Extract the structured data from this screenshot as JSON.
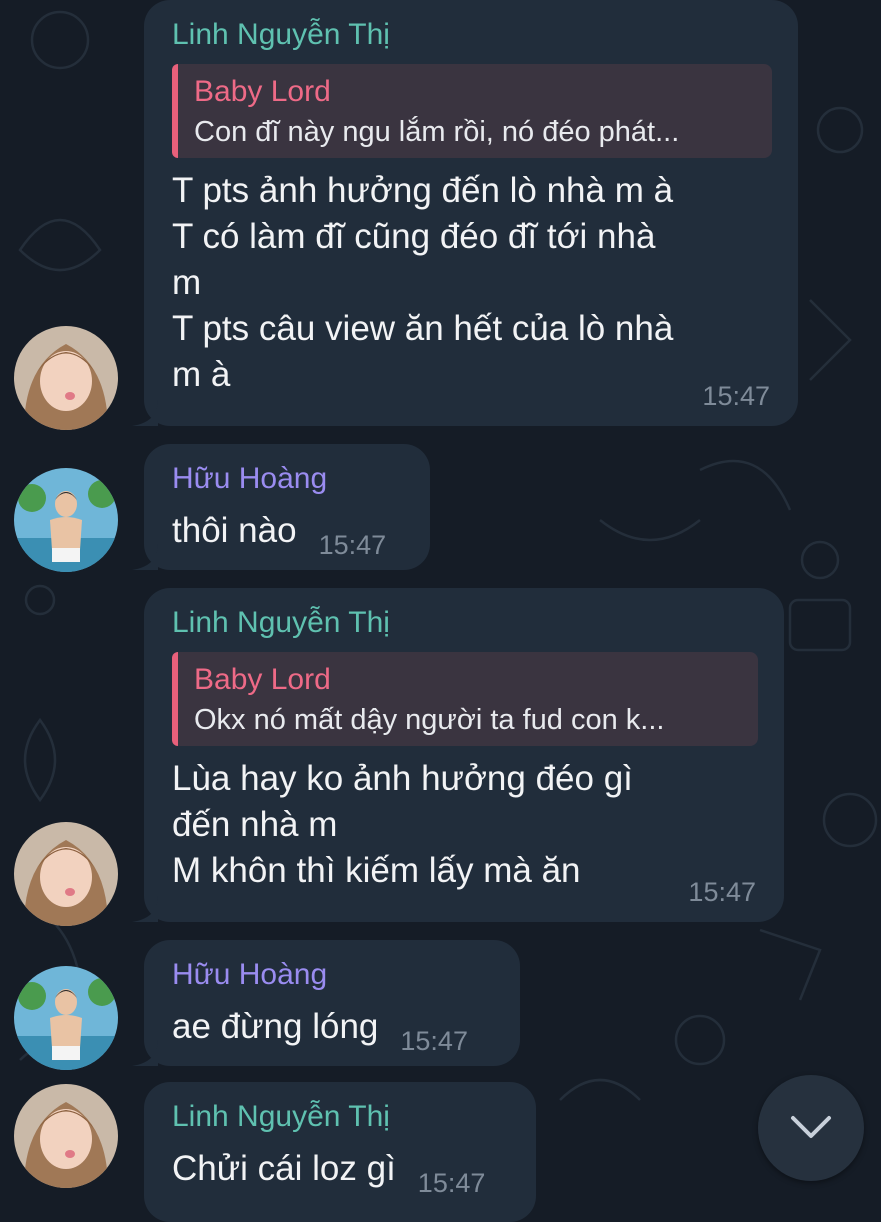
{
  "chat": {
    "messages": [
      {
        "sender": "Linh Nguyễn Thị",
        "reply": {
          "name": "Baby Lord",
          "text": "Con đĩ này ngu lắm rồi, nó đéo phát..."
        },
        "lines": [
          "T pts ảnh hưởng đến lò nhà m à",
          "T có làm đĩ cũng đéo đĩ tới nhà",
          "m",
          "T pts câu view ăn hết của lò nhà",
          "m à"
        ],
        "time": "15:47"
      },
      {
        "sender": "Hữu Hoàng",
        "text": "thôi nào",
        "time": "15:47"
      },
      {
        "sender": "Linh Nguyễn Thị",
        "reply": {
          "name": "Baby Lord",
          "text": "Okx nó mất dậy người ta fud con k..."
        },
        "lines": [
          "Lùa hay ko ảnh hưởng đéo gì",
          "đến nhà m",
          "M khôn thì kiếm lấy mà ăn"
        ],
        "time": "15:47"
      },
      {
        "sender": "Hữu Hoàng",
        "text": "ae đừng lóng",
        "time": "15:47"
      },
      {
        "sender": "Linh Nguyễn Thị",
        "text": "Chửi cái loz gì",
        "time": "15:47"
      }
    ]
  },
  "icons": {
    "scroll_down": "chevron-down-icon"
  },
  "colors": {
    "background": "#151c26",
    "bubble": "#212d3b",
    "linh_name": "#5fc1b0",
    "huu_name": "#9a8cf0",
    "reply_accent": "#e8607b"
  }
}
